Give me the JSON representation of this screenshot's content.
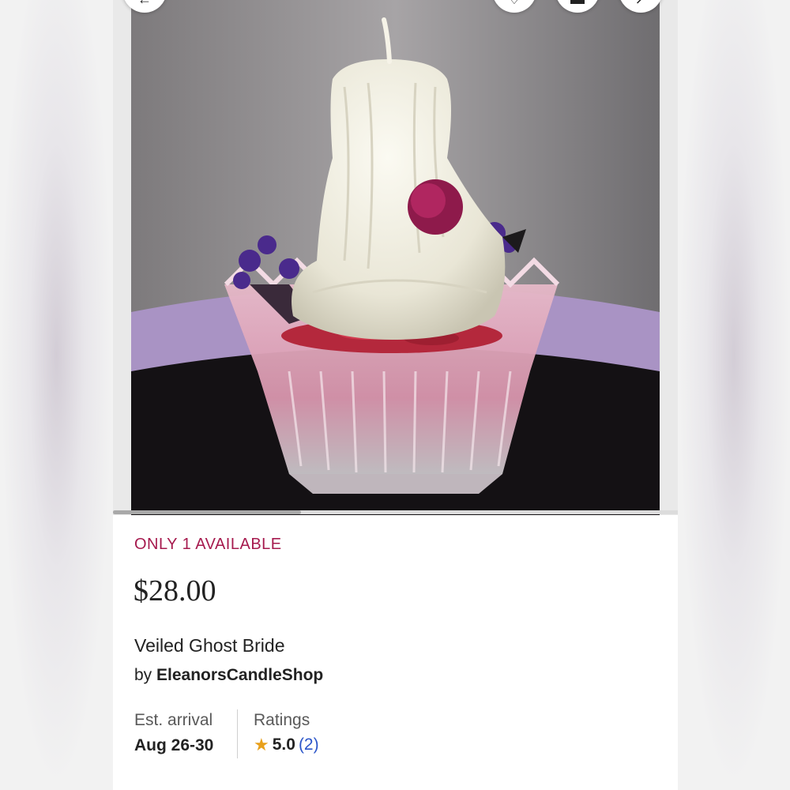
{
  "listing": {
    "availability": "ONLY 1 AVAILABLE",
    "price": "$28.00",
    "title": "Veiled Ghost Bride",
    "by_prefix": "by",
    "shop_name": "EleanorsCandleShop"
  },
  "details": {
    "est_arrival_label": "Est. arrival",
    "est_arrival_value": "Aug 26-30",
    "ratings_label": "Ratings",
    "rating_value": "5.0",
    "rating_count": "(2)"
  },
  "colors": {
    "availability": "#a61a4e",
    "star": "#e8a01b",
    "link": "#2c56c9"
  },
  "icons": {
    "back": "back-icon",
    "favorite": "heart-icon",
    "cart": "cart-icon",
    "share": "share-icon",
    "star": "star-icon"
  },
  "gallery": {
    "image_position": 1,
    "image_count": 3
  }
}
